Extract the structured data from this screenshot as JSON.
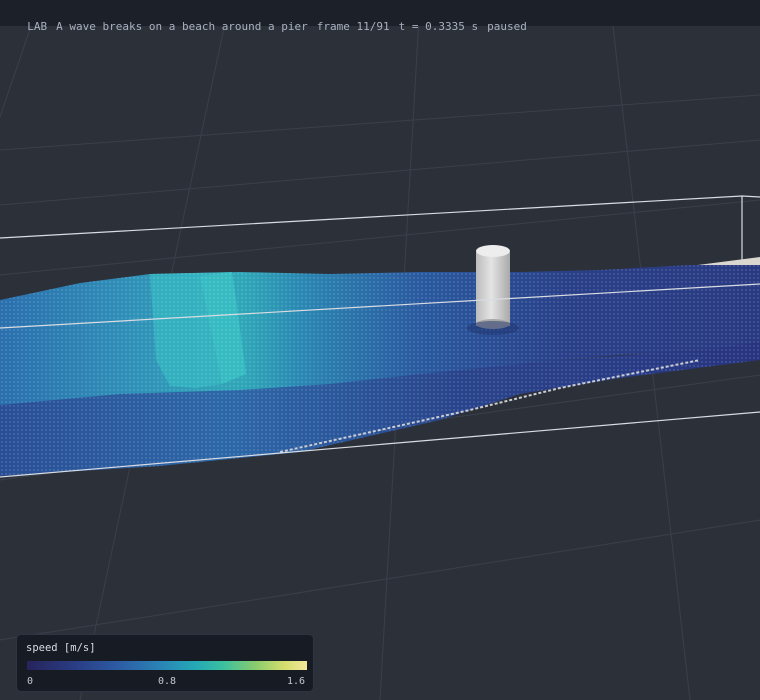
{
  "header": {
    "app": "LAB",
    "title": "A wave breaks on a beach around a pier",
    "frame": "frame 11/91",
    "time": "t = 0.3335 s",
    "status": "paused"
  },
  "legend": {
    "title": "speed  [m/s]",
    "min_label": "0",
    "mid_label": "0.8",
    "max_label": "1.6",
    "range": [
      0,
      1.6
    ]
  },
  "colors": {
    "background": "#2c3039",
    "grid": "#3a404b",
    "water_deep": "#283a86",
    "water_wave": "#34b4c0",
    "pier": "#d2d2d2",
    "beach": "#d9d7d0",
    "box_outline": "#d8dce2"
  }
}
